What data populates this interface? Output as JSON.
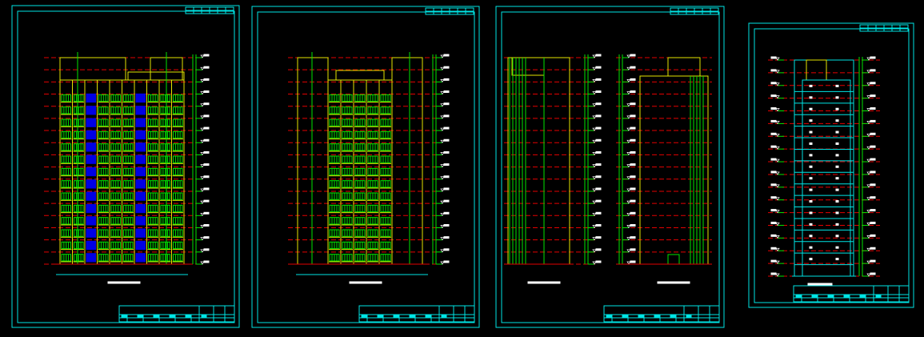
{
  "drawing": {
    "colors": {
      "frame": "#00e5e5",
      "wall": "#e5e500",
      "window": "#00e500",
      "glass": "#0000e5",
      "level_line": "#e50000",
      "ground": "#e50000"
    },
    "sheets": [
      {
        "name": "front-elevation-sheet",
        "floors": 17
      },
      {
        "name": "rear-elevation-sheet",
        "floors": 17
      },
      {
        "name": "side-elevations-sheet",
        "floors": 17
      },
      {
        "name": "section-sheet",
        "floors": 17
      }
    ]
  }
}
